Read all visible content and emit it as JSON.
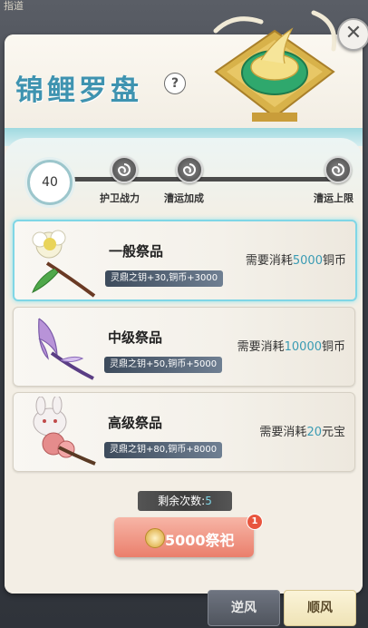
{
  "window": {
    "corner_text": "指道",
    "title": "锦鲤罗盘",
    "help_label": "?",
    "close_label": "✕"
  },
  "progress": {
    "current_level": "40",
    "milestones": [
      {
        "label": "护卫战力",
        "icon": "swirl-icon"
      },
      {
        "label": "漕运加成",
        "icon": "swirl-icon"
      },
      {
        "label": "漕运上限",
        "icon": "swirl-icon"
      }
    ]
  },
  "offerings": [
    {
      "name": "一般祭品",
      "tag": "灵鼎之钥+30,铜币+3000",
      "cost_prefix": "需要消耗",
      "cost_amount": "5000",
      "cost_unit": "铜币",
      "selected": true
    },
    {
      "name": "中级祭品",
      "tag": "灵鼎之钥+50,铜币+5000",
      "cost_prefix": "需要消耗",
      "cost_amount": "10000",
      "cost_unit": "铜币",
      "selected": false
    },
    {
      "name": "高级祭品",
      "tag": "灵鼎之钥+80,铜币+8000",
      "cost_prefix": "需要消耗",
      "cost_amount": "20",
      "cost_unit": "元宝",
      "selected": false
    }
  ],
  "remaining": {
    "label": "剩余次数:",
    "count": "5"
  },
  "action": {
    "pray_label": "5000祭祀",
    "badge": "1"
  },
  "tabs": [
    {
      "label": "逆风",
      "active": false
    },
    {
      "label": "顺风",
      "active": true
    }
  ],
  "colors": {
    "accent": "#3a9bb3",
    "title": "#3e93b0",
    "button": "#ea7f6c"
  }
}
